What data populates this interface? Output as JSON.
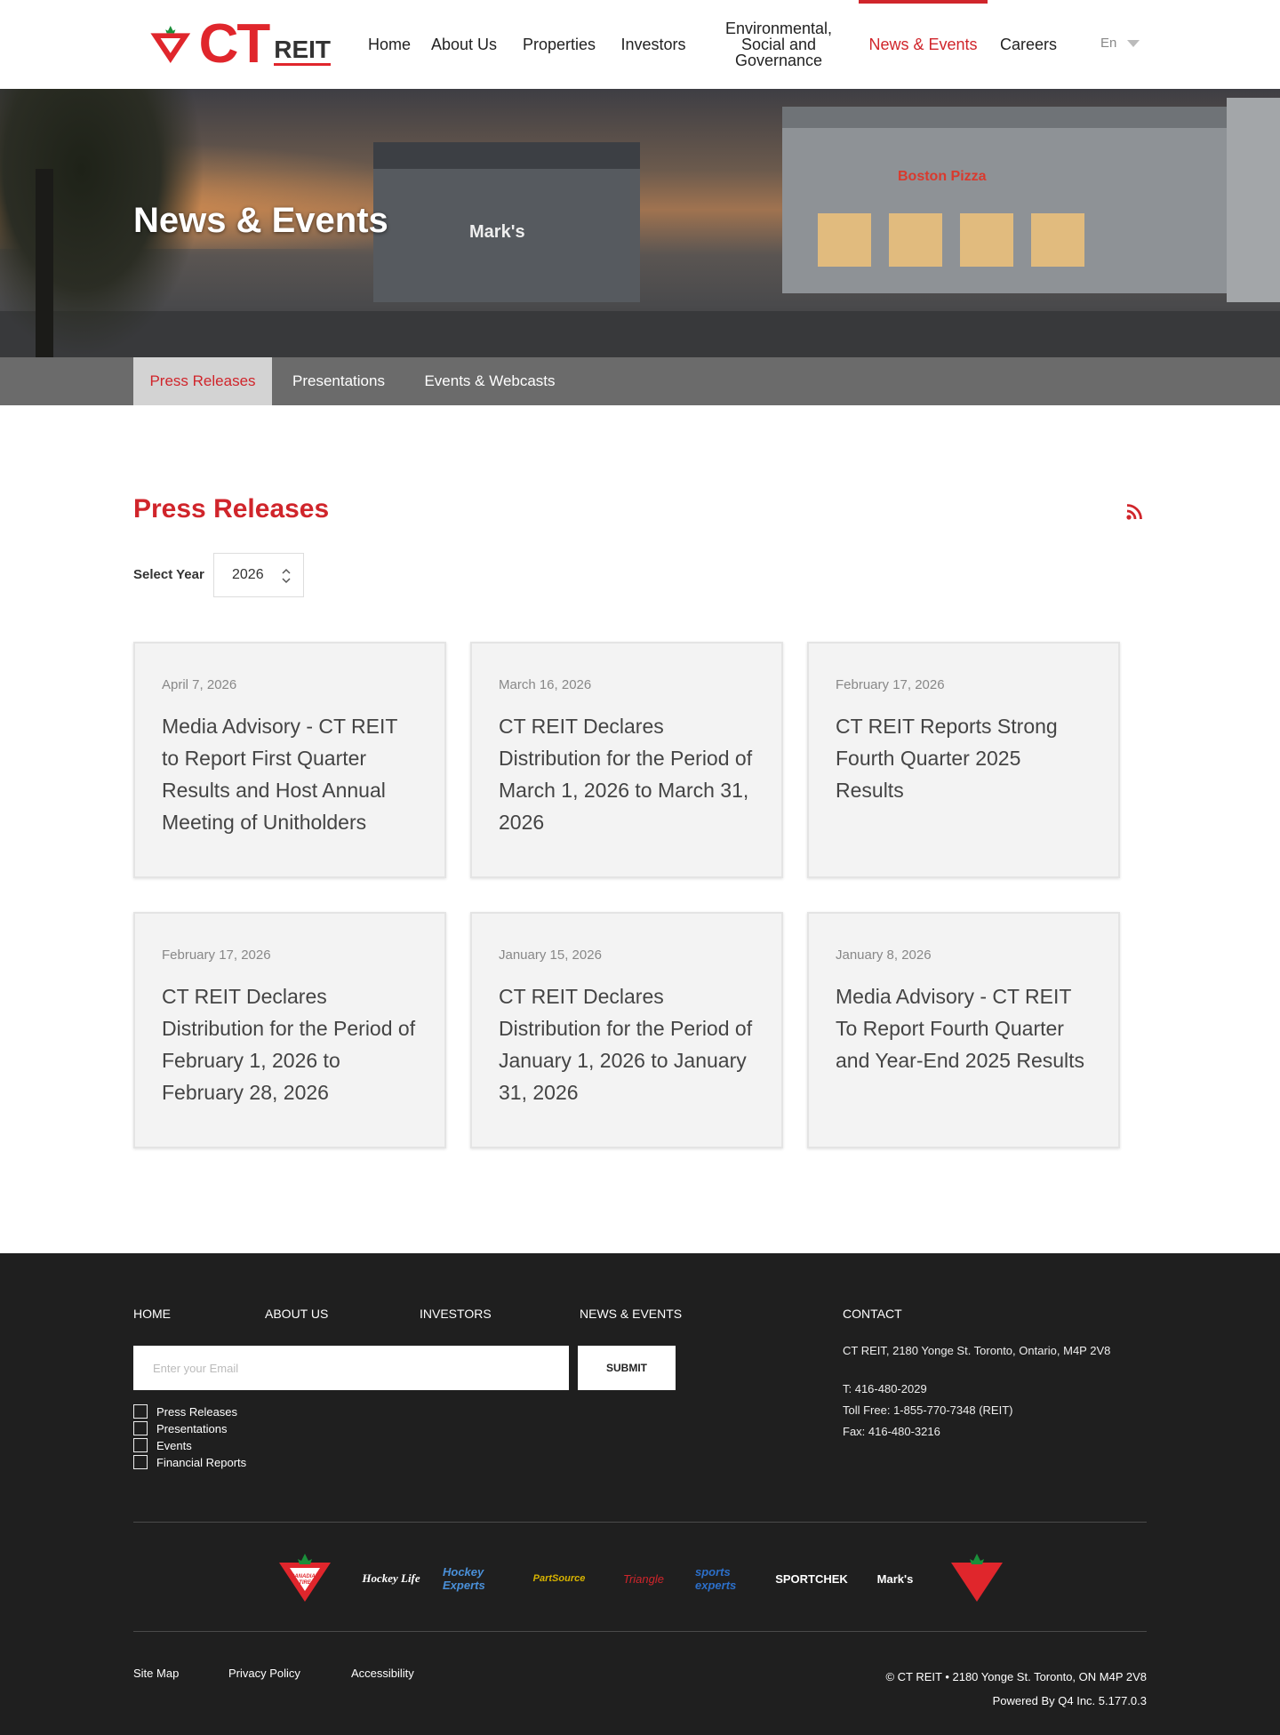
{
  "header": {
    "logo_ct": "CT",
    "logo_reit": "REIT",
    "nav": [
      {
        "label": "Home"
      },
      {
        "label": "About Us"
      },
      {
        "label": "Properties"
      },
      {
        "label": "Investors"
      },
      {
        "label": "Environmental, Social and Governance"
      },
      {
        "label": "News & Events"
      },
      {
        "label": "Careers"
      }
    ],
    "language": "En"
  },
  "hero": {
    "title": "News & Events",
    "sign_pizza": "Boston Pizza",
    "sign_marks": "Mark's"
  },
  "subnav": {
    "tabs": [
      {
        "label": "Press Releases"
      },
      {
        "label": "Presentations"
      },
      {
        "label": "Events & Webcasts"
      }
    ]
  },
  "main": {
    "section_title": "Press Releases",
    "year_label": "Select Year",
    "year_value": "2026",
    "releases": [
      {
        "date": "April 7, 2026",
        "title": "Media Advisory - CT REIT to Report First Quarter Results and Host Annual Meeting of Unitholders"
      },
      {
        "date": "March 16, 2026",
        "title": "CT REIT Declares Distribution for the Period of March 1, 2026 to March 31, 2026"
      },
      {
        "date": "February 17, 2026",
        "title": "CT REIT Reports Strong Fourth Quarter 2025 Results"
      },
      {
        "date": "February 17, 2026",
        "title": "CT REIT Declares Distribution for the Period of February 1, 2026 to February 28, 2026"
      },
      {
        "date": "January 15, 2026",
        "title": "CT REIT Declares Distribution for the Period of January 1, 2026 to January 31, 2026"
      },
      {
        "date": "January 8, 2026",
        "title": "Media Advisory - CT REIT To Report Fourth Quarter and Year-End 2025 Results"
      }
    ]
  },
  "footer": {
    "links": [
      "HOME",
      "ABOUT US",
      "INVESTORS",
      "NEWS & EVENTS"
    ],
    "email_placeholder": "Enter your Email",
    "submit_label": "SUBMIT",
    "subscriptions": [
      "Press Releases",
      "Presentations",
      "Events",
      "Financial Reports"
    ],
    "contact": {
      "heading": "CONTACT",
      "address": "CT REIT, 2180 Yonge St. Toronto, Ontario, M4P 2V8",
      "phone": "T: 416-480-2029",
      "toll_free": "Toll Free: 1-855-770-7348 (REIT)",
      "fax": "Fax: 416-480-3216"
    },
    "brands": [
      {
        "name": "canadian-tire-logo",
        "label": ""
      },
      {
        "name": "hockey-life-logo",
        "label": "Hockey Life"
      },
      {
        "name": "hockey-experts-logo",
        "label": "Hockey Experts"
      },
      {
        "name": "partsource-logo",
        "label": "PartSource"
      },
      {
        "name": "triangle-logo",
        "label": "Triangle"
      },
      {
        "name": "sports-experts-logo",
        "label": "sports experts"
      },
      {
        "name": "sportchek-logo",
        "label": "SPORTCHEK"
      },
      {
        "name": "marks-logo",
        "label": "Mark's"
      },
      {
        "name": "canadian-tire-triangle-logo",
        "label": ""
      }
    ],
    "bottom_links": [
      "Site Map",
      "Privacy Policy",
      "Accessibility"
    ],
    "copyright": "© CT REIT • 2180 Yonge St. Toronto, ON M4P 2V8",
    "powered_by": "Powered By Q4 Inc. 5.177.0.3"
  },
  "colors": {
    "brand_red": "#d0252b",
    "subnav_bg": "#6b6b6b",
    "footer_bg": "#1f1f1f"
  }
}
